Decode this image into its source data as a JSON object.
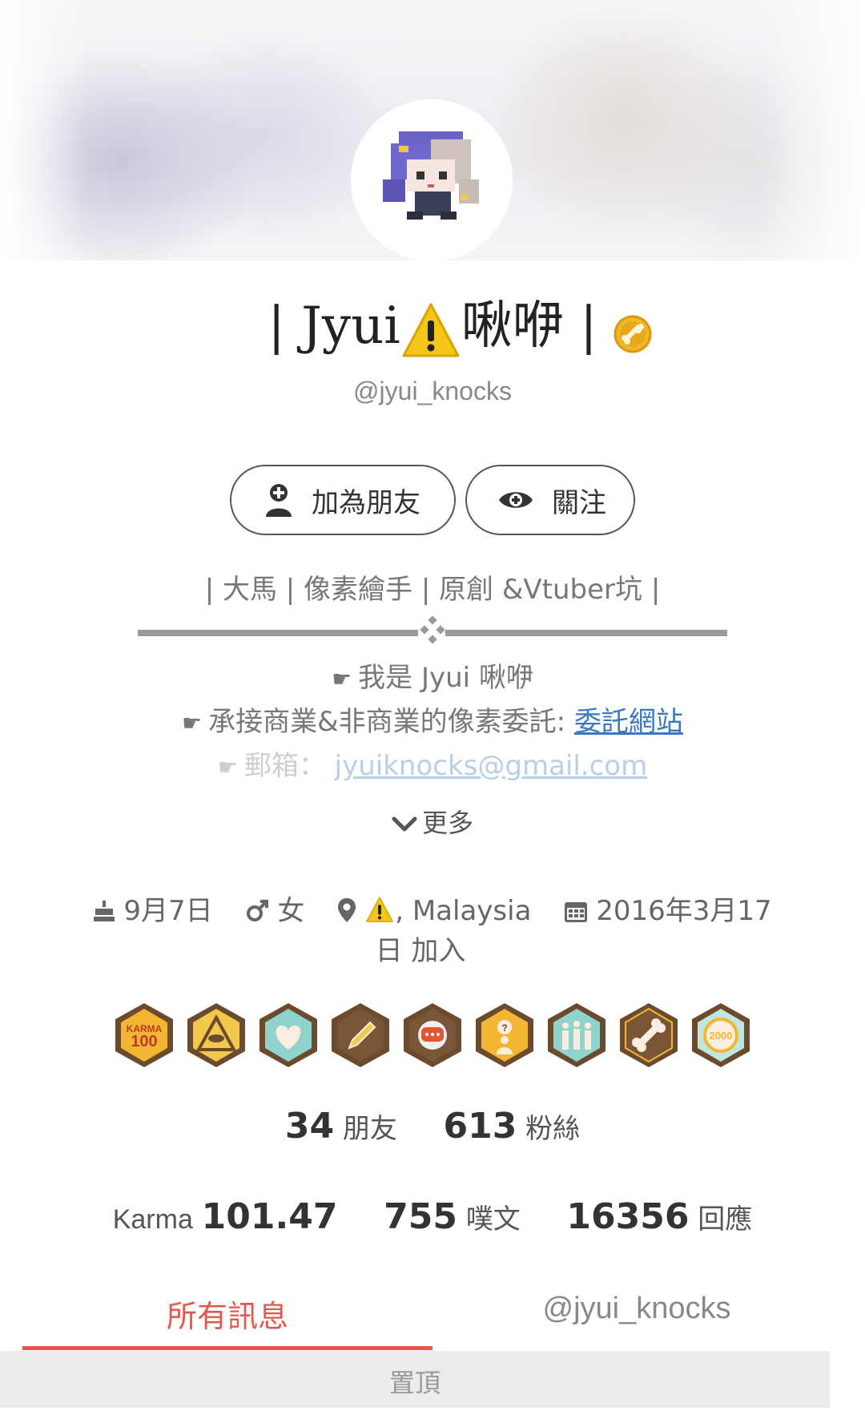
{
  "profile": {
    "display_name_prefix": "| Jyui",
    "display_name_suffix": "啾咿 |",
    "handle": "@jyui_knocks"
  },
  "actions": {
    "add_friend_label": "加為朋友",
    "follow_label": "關注"
  },
  "bio": {
    "title": "| 大馬 | 像素繪手 | 原創 &Vtuber坑 |",
    "line1": "我是 Jyui 啾咿",
    "line2_text": "承接商業&非商業的像素委託: ",
    "line2_link": "委託網站",
    "line3_text": "郵箱： ",
    "line3_link": "jyuiknocks@gmail.com",
    "hand_glyph": "☛",
    "more_label": "更多"
  },
  "meta": {
    "birthday": "9月7日",
    "gender": "女",
    "location": ", Malaysia",
    "joined": "2016年3月17日 加入"
  },
  "badges": [
    "karma-100-badge",
    "eye-pyramid-badge",
    "heart-badge",
    "pencil-badge",
    "chat-bubble-badge",
    "question-person-badge",
    "group-cheer-badge",
    "bone-badge",
    "2000-badge"
  ],
  "badge_text": {
    "karma_word": "KARMA",
    "karma_num": "100",
    "count_2000": "2000"
  },
  "stats": {
    "friends_count": "34",
    "friends_label": "朋友",
    "fans_count": "613",
    "fans_label": "粉絲",
    "karma_label": "Karma",
    "karma_value": "101.47",
    "posts_count": "755",
    "posts_label": "噗文",
    "replies_count": "16356",
    "replies_label": "回應"
  },
  "tabs": {
    "all_label": "所有訊息",
    "user_label": "@jyui_knocks"
  },
  "pinned_label": "置頂",
  "colors": {
    "accent_red": "#e05a50",
    "link_blue": "#3a78c2",
    "badge_brown": "#6b4a2e",
    "badge_gold": "#f2b632"
  }
}
